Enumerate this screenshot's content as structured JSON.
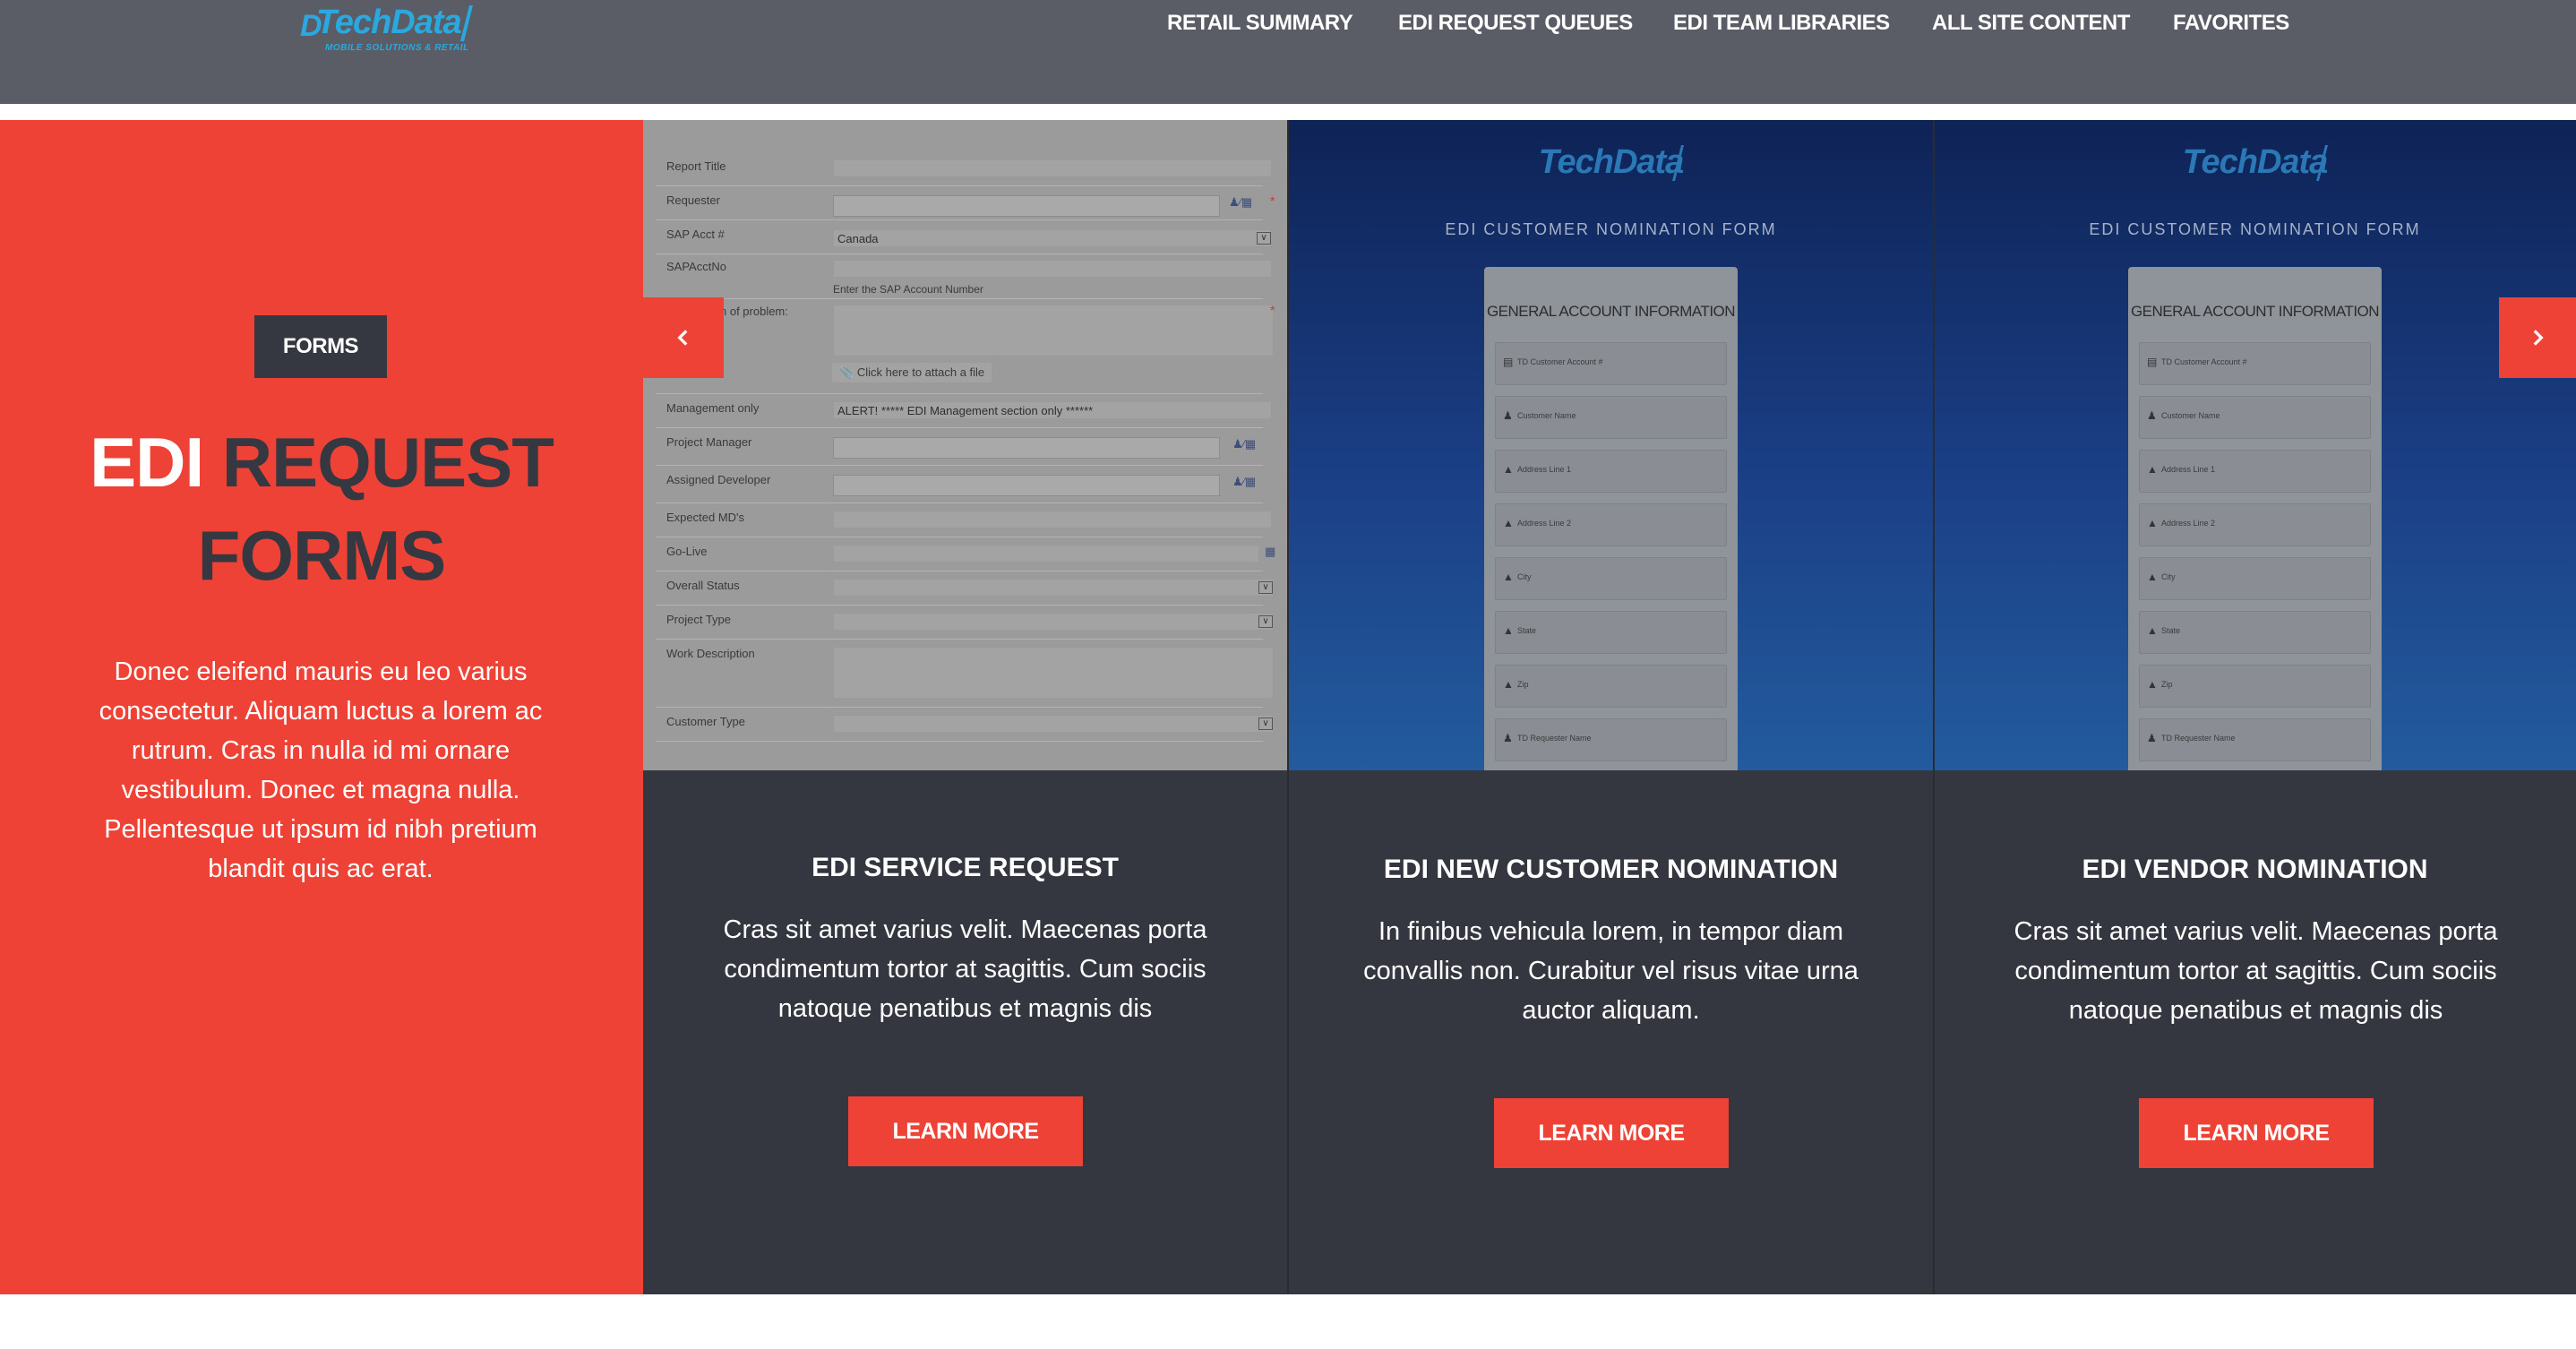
{
  "header": {
    "logo": {
      "brand": "TechData",
      "tagline": "MOBILE SOLUTIONS & RETAIL"
    },
    "nav": [
      {
        "label": "RETAIL SUMMARY"
      },
      {
        "label": "EDI REQUEST QUEUES"
      },
      {
        "label": "EDI TEAM LIBRARIES"
      },
      {
        "label": "ALL SITE CONTENT"
      },
      {
        "label": "FAVORITES"
      }
    ]
  },
  "intro": {
    "tag": "FORMS",
    "title_word1": "EDI",
    "title_word2": "REQUEST",
    "title_line2": "FORMS",
    "description": "Donec eleifend mauris eu leo varius consectetur. Aliquam luctus a lorem ac rutrum. Cras in nulla id mi ornare vestibulum. Donec et magna nulla. Pellentesque ut ipsum id nibh pretium blandit quis ac erat."
  },
  "cards": [
    {
      "title": "EDI SERVICE REQUEST",
      "text": "Cras sit amet varius velit. Maecenas porta condimentum tortor at sagittis. Cum sociis natoque penatibus et magnis dis",
      "button": "LEARN MORE",
      "screenshot": {
        "rows": [
          {
            "label": "Report Title",
            "value": ""
          },
          {
            "label": "Requester",
            "value": ""
          },
          {
            "label": "SAP Acct #",
            "value": "Canada"
          },
          {
            "label": "SAPAcctNo",
            "value": "",
            "hint": "Enter the SAP Account Number"
          },
          {
            "label": "n of problem:",
            "value": "",
            "attach": "Click here to attach a file"
          },
          {
            "label": "Management only",
            "value": "ALERT! ***** EDI Management section only ******"
          },
          {
            "label": "Project Manager",
            "value": ""
          },
          {
            "label": "Assigned Developer",
            "value": ""
          },
          {
            "label": "Expected MD's",
            "value": ""
          },
          {
            "label": "Go-Live",
            "value": ""
          },
          {
            "label": "Overall Status",
            "value": ""
          },
          {
            "label": "Project Type",
            "value": ""
          },
          {
            "label": "Work Description",
            "value": ""
          },
          {
            "label": "Customer Type",
            "value": ""
          }
        ]
      }
    },
    {
      "title": "EDI NEW CUSTOMER NOMINATION",
      "text": "In finibus vehicula lorem, in tempor diam convallis non. Curabitur vel risus vitae urna auctor aliquam.",
      "button": "LEARN MORE",
      "screenshot": {
        "logo": "TechData",
        "subtitle": "EDI CUSTOMER NOMINATION FORM",
        "section": "GENERAL ACCOUNT INFORMATION",
        "fields": [
          "TD Customer Account #",
          "Customer Name",
          "Address Line 1",
          "Address Line 2",
          "City",
          "State",
          "Zip",
          "TD Requester Name"
        ]
      }
    },
    {
      "title": "EDI VENDOR NOMINATION",
      "text": "Cras sit amet varius velit. Maecenas porta condimentum tortor at sagittis. Cum sociis natoque penatibus et magnis dis",
      "button": "LEARN MORE",
      "screenshot": {
        "logo": "TechData",
        "subtitle": "EDI CUSTOMER NOMINATION FORM",
        "section": "GENERAL ACCOUNT INFORMATION",
        "fields": [
          "TD Customer Account #",
          "Customer Name",
          "Address Line 1",
          "Address Line 2",
          "City",
          "State",
          "Zip",
          "TD Requester Name"
        ]
      }
    }
  ],
  "carousel": {
    "prev_icon": "chevron-left-icon",
    "next_icon": "chevron-right-icon"
  },
  "colors": {
    "accent": "#ef4236",
    "dark": "#343640",
    "header": "#5a5d65",
    "logo_blue": "#2aa9e0"
  }
}
